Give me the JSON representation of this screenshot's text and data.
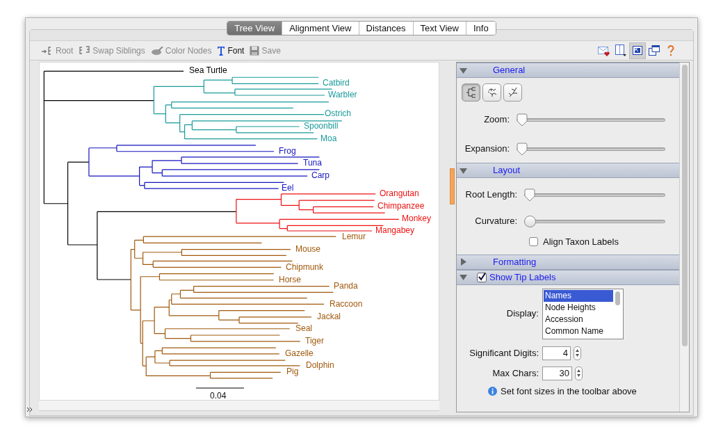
{
  "tabs": [
    {
      "label": "Tree View",
      "selected": true
    },
    {
      "label": "Alignment View",
      "selected": false
    },
    {
      "label": "Distances",
      "selected": false
    },
    {
      "label": "Text View",
      "selected": false
    },
    {
      "label": "Info",
      "selected": false
    }
  ],
  "toolbar": [
    {
      "kind": "root",
      "label": "Root",
      "disabled": true
    },
    {
      "kind": "swap",
      "label": "Swap Siblings",
      "disabled": true
    },
    {
      "kind": "color",
      "label": "Color Nodes",
      "disabled": true
    },
    {
      "kind": "font",
      "label": "Font",
      "disabled": false
    },
    {
      "kind": "save",
      "label": "Save",
      "disabled": true
    }
  ],
  "view_tools": [
    {
      "kind": "mail",
      "selected": false
    },
    {
      "kind": "columns",
      "selected": false
    },
    {
      "kind": "frame",
      "selected": true
    },
    {
      "kind": "windows",
      "selected": false
    },
    {
      "kind": "help",
      "selected": false
    }
  ],
  "tree": {
    "clades": [
      {
        "color": "#000000",
        "taxa": [
          "Sea Turtle"
        ]
      },
      {
        "color": "#1a9a9a",
        "taxa": [
          "Catbird",
          "Warbler",
          "Ostrich",
          "Spoonbill",
          "Moa"
        ]
      },
      {
        "color": "#1515c0",
        "taxa": [
          "Frog",
          "Tuna",
          "Carp",
          "Eel"
        ]
      },
      {
        "color": "#ee1111",
        "taxa": [
          "Orangutan",
          "Chimpanzee",
          "Monkey",
          "Mangabey"
        ]
      },
      {
        "color": "#a0580c",
        "taxa": [
          "Lemur",
          "Mouse",
          "Chipmunk",
          "Horse",
          "Panda",
          "Raccoon",
          "Jackal",
          "Seal",
          "Tiger",
          "Gazelle",
          "Dolphin",
          "Pig"
        ]
      }
    ],
    "scale_label": "0.04"
  },
  "general": {
    "title": "General",
    "expanded": true,
    "layouts": [
      {
        "kind": "rectangular",
        "selected": true
      },
      {
        "kind": "polar",
        "selected": false
      },
      {
        "kind": "radial",
        "selected": false
      }
    ],
    "sliders": [
      {
        "label": "Zoom:",
        "kind": "pointer",
        "level": 0
      },
      {
        "label": "Expansion:",
        "kind": "pointer",
        "level": 0
      }
    ]
  },
  "layout": {
    "title": "Layout",
    "expanded": true,
    "sliders": [
      {
        "label": "Root Length:",
        "kind": "pointer",
        "level": 0
      },
      {
        "label": "Curvature:",
        "kind": "round",
        "level": 0
      }
    ],
    "align": {
      "label": "Align Taxon Labels",
      "checked": false
    }
  },
  "formatting": {
    "title": "Formatting",
    "expanded": false
  },
  "tip_labels": {
    "title": "Show Tip Labels",
    "expanded": true,
    "checked": true,
    "display": {
      "label": "Display:",
      "options": [
        {
          "label": "Names",
          "selected": true
        },
        {
          "label": "Node Heights",
          "selected": false
        },
        {
          "label": "Accession",
          "selected": false
        },
        {
          "label": "Common Name",
          "selected": false
        }
      ]
    },
    "digits": {
      "label": "Significant Digits:",
      "value": "4"
    },
    "max_chars": {
      "label": "Max Chars:",
      "value": "30"
    },
    "hint": "Set font sizes in the toolbar above"
  }
}
